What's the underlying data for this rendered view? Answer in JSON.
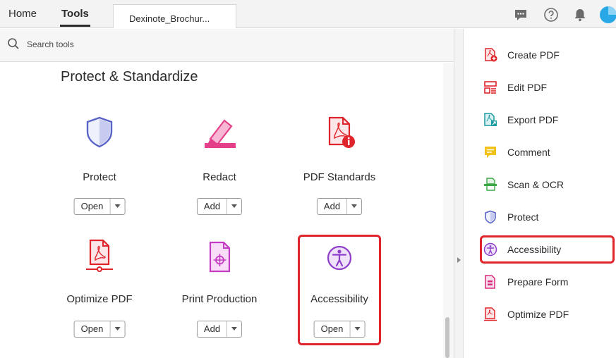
{
  "topbar": {
    "home_label": "Home",
    "tools_label": "Tools",
    "doc_tab_label": "Dexinote_Brochur..."
  },
  "search": {
    "placeholder": "Search tools"
  },
  "section": {
    "title": "Protect & Standardize"
  },
  "tools": [
    {
      "name": "Protect",
      "button": "Open",
      "icon": "shield-icon"
    },
    {
      "name": "Redact",
      "button": "Add",
      "icon": "redact-marker-icon"
    },
    {
      "name": "PDF Standards",
      "button": "Add",
      "icon": "pdf-standards-icon"
    },
    {
      "name": "Optimize PDF",
      "button": "Open",
      "icon": "optimize-pdf-icon"
    },
    {
      "name": "Print Production",
      "button": "Add",
      "icon": "print-production-icon"
    },
    {
      "name": "Accessibility",
      "button": "Open",
      "icon": "accessibility-icon"
    }
  ],
  "right_panel": [
    {
      "label": "Create PDF",
      "icon": "create-pdf-icon",
      "color": "#e0242c"
    },
    {
      "label": "Edit PDF",
      "icon": "edit-pdf-icon",
      "color": "#e0242c"
    },
    {
      "label": "Export PDF",
      "icon": "export-pdf-icon",
      "color": "#1b9aa0"
    },
    {
      "label": "Comment",
      "icon": "comment-icon",
      "color": "#f2c21b"
    },
    {
      "label": "Scan & OCR",
      "icon": "scan-ocr-icon",
      "color": "#3aa845"
    },
    {
      "label": "Protect",
      "icon": "shield-icon",
      "color": "#5a64c8"
    },
    {
      "label": "Accessibility",
      "icon": "accessibility-icon",
      "color": "#8e3ec9"
    },
    {
      "label": "Prepare Form",
      "icon": "prepare-form-icon",
      "color": "#d6297a"
    },
    {
      "label": "Optimize PDF",
      "icon": "optimize-pdf-icon",
      "color": "#e0242c"
    }
  ],
  "colors": {
    "highlight": "#e0242c",
    "protect": "#5a64c8",
    "redact": "#e5408a",
    "pdf_red": "#e0242c",
    "print_production": "#c43cc4",
    "accessibility": "#8e3ec9",
    "avatar": "#29a8e8"
  }
}
